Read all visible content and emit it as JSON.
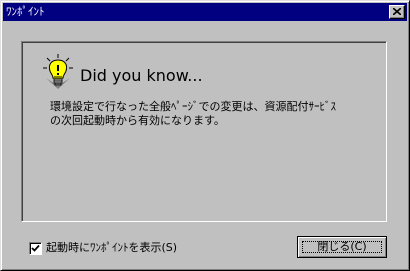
{
  "window": {
    "title": "ﾜﾝﾎﾟｲﾝﾄ"
  },
  "tip": {
    "heading": "Did you know...",
    "line1": "環境設定で行なった全般ﾍﾟｰｼﾞでの変更は、資源配付ｻｰﾋﾞｽ",
    "line2": "の次回起動時から有効になります。"
  },
  "footer": {
    "checkbox_label": "起動時にﾜﾝﾎﾟｲﾝﾄを表示(S)",
    "checkbox_checked": true,
    "close_label": "閉じる(C)"
  },
  "icons": {
    "bulb": "lightbulb-icon",
    "close": "close-icon",
    "check": "checkmark-icon"
  }
}
